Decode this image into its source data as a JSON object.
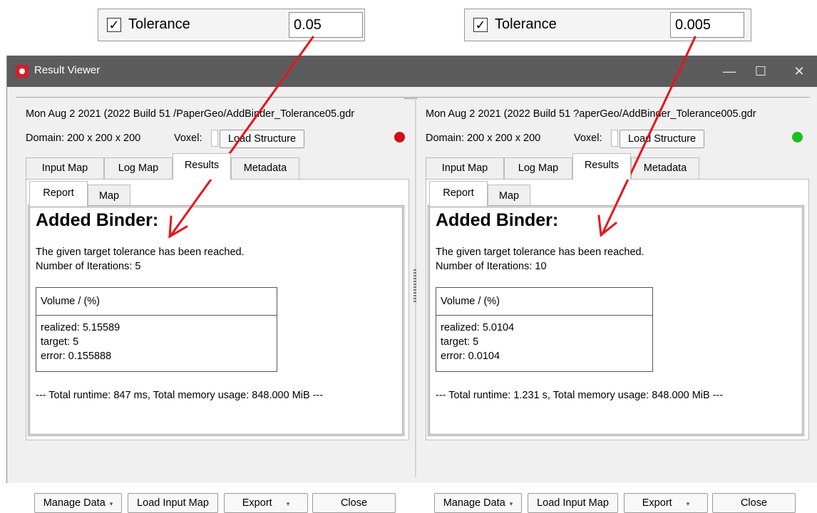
{
  "tolerance_panels": [
    {
      "checkbox": "✓",
      "label": "Tolerance",
      "value": "0.05"
    },
    {
      "checkbox": "✓",
      "label": "Tolerance",
      "value": "0.005"
    }
  ],
  "window": {
    "title": "Result Viewer",
    "controls": {
      "minimize": "—",
      "maximize": "☐",
      "close": "✕"
    }
  },
  "panes": [
    {
      "path": "Mon Aug 2 2021 (2022 Build 51 /PaperGeo/AddBinder_Tolerance05.gdr",
      "domain": "Domain: 200 x 200 x 200",
      "voxel_label": "Voxel:",
      "load_structure": "Load Structure",
      "status_color": "#d10f12",
      "tabs": [
        "Input Map",
        "Log Map",
        "Results",
        "Metadata"
      ],
      "active_tab": "Results",
      "subtabs": [
        "Report",
        "Map"
      ],
      "report": {
        "heading": "Added Binder:",
        "message": "The given target tolerance has been reached.",
        "iterations": "Number of Iterations: 5",
        "table_header": "Volume / (%)",
        "realized": "realized: 5.15589",
        "target": "target: 5",
        "error": "error: 0.155888",
        "runtime": "--- Total runtime: 847 ms, Total memory usage: 848.000 MiB ---"
      },
      "buttons": {
        "manage": "Manage Data",
        "load_input": "Load Input Map",
        "export": "Export",
        "close": "Close"
      }
    },
    {
      "path": "Mon Aug 2 2021 (2022 Build 51 ?aperGeo/AddBinder_Tolerance005.gdr",
      "domain": "Domain: 200 x 200 x 200",
      "voxel_label": "Voxel:",
      "load_structure": "Load Structure",
      "status_color": "#18c21c",
      "tabs": [
        "Input Map",
        "Log Map",
        "Results",
        "Metadata"
      ],
      "active_tab": "Results",
      "subtabs": [
        "Report",
        "Map"
      ],
      "report": {
        "heading": "Added Binder:",
        "message": "The given target tolerance has been reached.",
        "iterations": "Number of Iterations: 10",
        "table_header": "Volume / (%)",
        "realized": "realized: 5.0104",
        "target": "target: 5",
        "error": "error: 0.0104",
        "runtime": "--- Total runtime: 1.231 s, Total memory usage: 848.000 MiB ---"
      },
      "buttons": {
        "manage": "Manage Data",
        "load_input": "Load Input Map",
        "export": "Export",
        "close": "Close"
      }
    }
  ],
  "splitter_grip": "........",
  "dropdown_glyph": "▾",
  "annotation_arrow_color": "#e8141c"
}
